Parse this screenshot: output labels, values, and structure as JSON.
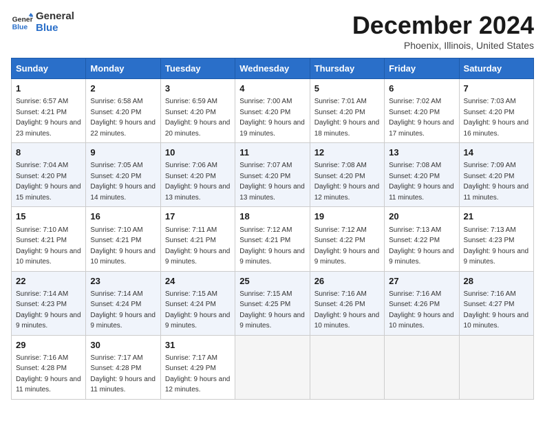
{
  "logo": {
    "line1": "General",
    "line2": "Blue"
  },
  "title": "December 2024",
  "subtitle": "Phoenix, Illinois, United States",
  "headers": [
    "Sunday",
    "Monday",
    "Tuesday",
    "Wednesday",
    "Thursday",
    "Friday",
    "Saturday"
  ],
  "weeks": [
    [
      {
        "day": "1",
        "sunrise": "6:57 AM",
        "sunset": "4:21 PM",
        "daylight": "9 hours and 23 minutes."
      },
      {
        "day": "2",
        "sunrise": "6:58 AM",
        "sunset": "4:20 PM",
        "daylight": "9 hours and 22 minutes."
      },
      {
        "day": "3",
        "sunrise": "6:59 AM",
        "sunset": "4:20 PM",
        "daylight": "9 hours and 20 minutes."
      },
      {
        "day": "4",
        "sunrise": "7:00 AM",
        "sunset": "4:20 PM",
        "daylight": "9 hours and 19 minutes."
      },
      {
        "day": "5",
        "sunrise": "7:01 AM",
        "sunset": "4:20 PM",
        "daylight": "9 hours and 18 minutes."
      },
      {
        "day": "6",
        "sunrise": "7:02 AM",
        "sunset": "4:20 PM",
        "daylight": "9 hours and 17 minutes."
      },
      {
        "day": "7",
        "sunrise": "7:03 AM",
        "sunset": "4:20 PM",
        "daylight": "9 hours and 16 minutes."
      }
    ],
    [
      {
        "day": "8",
        "sunrise": "7:04 AM",
        "sunset": "4:20 PM",
        "daylight": "9 hours and 15 minutes."
      },
      {
        "day": "9",
        "sunrise": "7:05 AM",
        "sunset": "4:20 PM",
        "daylight": "9 hours and 14 minutes."
      },
      {
        "day": "10",
        "sunrise": "7:06 AM",
        "sunset": "4:20 PM",
        "daylight": "9 hours and 13 minutes."
      },
      {
        "day": "11",
        "sunrise": "7:07 AM",
        "sunset": "4:20 PM",
        "daylight": "9 hours and 13 minutes."
      },
      {
        "day": "12",
        "sunrise": "7:08 AM",
        "sunset": "4:20 PM",
        "daylight": "9 hours and 12 minutes."
      },
      {
        "day": "13",
        "sunrise": "7:08 AM",
        "sunset": "4:20 PM",
        "daylight": "9 hours and 11 minutes."
      },
      {
        "day": "14",
        "sunrise": "7:09 AM",
        "sunset": "4:20 PM",
        "daylight": "9 hours and 11 minutes."
      }
    ],
    [
      {
        "day": "15",
        "sunrise": "7:10 AM",
        "sunset": "4:21 PM",
        "daylight": "9 hours and 10 minutes."
      },
      {
        "day": "16",
        "sunrise": "7:10 AM",
        "sunset": "4:21 PM",
        "daylight": "9 hours and 10 minutes."
      },
      {
        "day": "17",
        "sunrise": "7:11 AM",
        "sunset": "4:21 PM",
        "daylight": "9 hours and 9 minutes."
      },
      {
        "day": "18",
        "sunrise": "7:12 AM",
        "sunset": "4:21 PM",
        "daylight": "9 hours and 9 minutes."
      },
      {
        "day": "19",
        "sunrise": "7:12 AM",
        "sunset": "4:22 PM",
        "daylight": "9 hours and 9 minutes."
      },
      {
        "day": "20",
        "sunrise": "7:13 AM",
        "sunset": "4:22 PM",
        "daylight": "9 hours and 9 minutes."
      },
      {
        "day": "21",
        "sunrise": "7:13 AM",
        "sunset": "4:23 PM",
        "daylight": "9 hours and 9 minutes."
      }
    ],
    [
      {
        "day": "22",
        "sunrise": "7:14 AM",
        "sunset": "4:23 PM",
        "daylight": "9 hours and 9 minutes."
      },
      {
        "day": "23",
        "sunrise": "7:14 AM",
        "sunset": "4:24 PM",
        "daylight": "9 hours and 9 minutes."
      },
      {
        "day": "24",
        "sunrise": "7:15 AM",
        "sunset": "4:24 PM",
        "daylight": "9 hours and 9 minutes."
      },
      {
        "day": "25",
        "sunrise": "7:15 AM",
        "sunset": "4:25 PM",
        "daylight": "9 hours and 9 minutes."
      },
      {
        "day": "26",
        "sunrise": "7:16 AM",
        "sunset": "4:26 PM",
        "daylight": "9 hours and 10 minutes."
      },
      {
        "day": "27",
        "sunrise": "7:16 AM",
        "sunset": "4:26 PM",
        "daylight": "9 hours and 10 minutes."
      },
      {
        "day": "28",
        "sunrise": "7:16 AM",
        "sunset": "4:27 PM",
        "daylight": "9 hours and 10 minutes."
      }
    ],
    [
      {
        "day": "29",
        "sunrise": "7:16 AM",
        "sunset": "4:28 PM",
        "daylight": "9 hours and 11 minutes."
      },
      {
        "day": "30",
        "sunrise": "7:17 AM",
        "sunset": "4:28 PM",
        "daylight": "9 hours and 11 minutes."
      },
      {
        "day": "31",
        "sunrise": "7:17 AM",
        "sunset": "4:29 PM",
        "daylight": "9 hours and 12 minutes."
      },
      null,
      null,
      null,
      null
    ]
  ],
  "labels": {
    "sunrise": "Sunrise:",
    "sunset": "Sunset:",
    "daylight": "Daylight:"
  }
}
